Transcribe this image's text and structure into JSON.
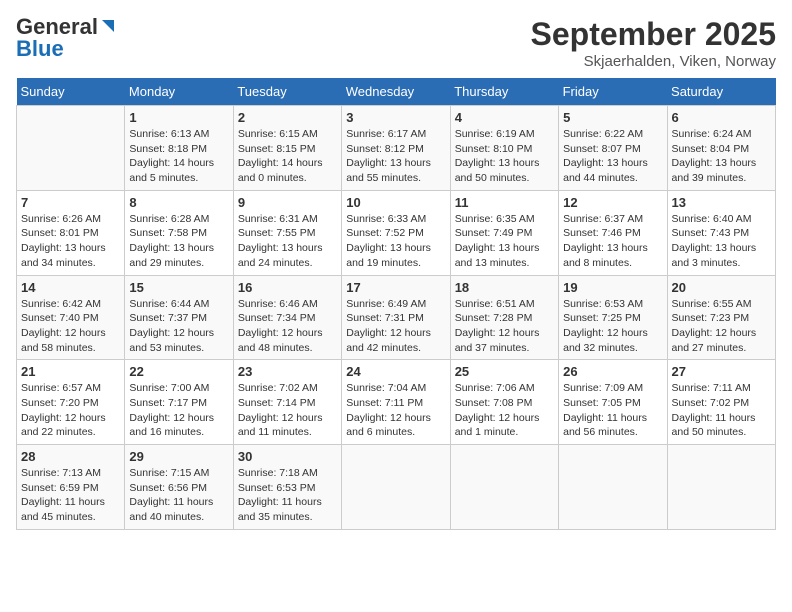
{
  "header": {
    "logo_line1": "General",
    "logo_line2": "Blue",
    "title": "September 2025",
    "subtitle": "Skjaerhalden, Viken, Norway"
  },
  "days_of_week": [
    "Sunday",
    "Monday",
    "Tuesday",
    "Wednesday",
    "Thursday",
    "Friday",
    "Saturday"
  ],
  "weeks": [
    [
      {
        "day": "",
        "content": ""
      },
      {
        "day": "1",
        "content": "Sunrise: 6:13 AM\nSunset: 8:18 PM\nDaylight: 14 hours\nand 5 minutes."
      },
      {
        "day": "2",
        "content": "Sunrise: 6:15 AM\nSunset: 8:15 PM\nDaylight: 14 hours\nand 0 minutes."
      },
      {
        "day": "3",
        "content": "Sunrise: 6:17 AM\nSunset: 8:12 PM\nDaylight: 13 hours\nand 55 minutes."
      },
      {
        "day": "4",
        "content": "Sunrise: 6:19 AM\nSunset: 8:10 PM\nDaylight: 13 hours\nand 50 minutes."
      },
      {
        "day": "5",
        "content": "Sunrise: 6:22 AM\nSunset: 8:07 PM\nDaylight: 13 hours\nand 44 minutes."
      },
      {
        "day": "6",
        "content": "Sunrise: 6:24 AM\nSunset: 8:04 PM\nDaylight: 13 hours\nand 39 minutes."
      }
    ],
    [
      {
        "day": "7",
        "content": "Sunrise: 6:26 AM\nSunset: 8:01 PM\nDaylight: 13 hours\nand 34 minutes."
      },
      {
        "day": "8",
        "content": "Sunrise: 6:28 AM\nSunset: 7:58 PM\nDaylight: 13 hours\nand 29 minutes."
      },
      {
        "day": "9",
        "content": "Sunrise: 6:31 AM\nSunset: 7:55 PM\nDaylight: 13 hours\nand 24 minutes."
      },
      {
        "day": "10",
        "content": "Sunrise: 6:33 AM\nSunset: 7:52 PM\nDaylight: 13 hours\nand 19 minutes."
      },
      {
        "day": "11",
        "content": "Sunrise: 6:35 AM\nSunset: 7:49 PM\nDaylight: 13 hours\nand 13 minutes."
      },
      {
        "day": "12",
        "content": "Sunrise: 6:37 AM\nSunset: 7:46 PM\nDaylight: 13 hours\nand 8 minutes."
      },
      {
        "day": "13",
        "content": "Sunrise: 6:40 AM\nSunset: 7:43 PM\nDaylight: 13 hours\nand 3 minutes."
      }
    ],
    [
      {
        "day": "14",
        "content": "Sunrise: 6:42 AM\nSunset: 7:40 PM\nDaylight: 12 hours\nand 58 minutes."
      },
      {
        "day": "15",
        "content": "Sunrise: 6:44 AM\nSunset: 7:37 PM\nDaylight: 12 hours\nand 53 minutes."
      },
      {
        "day": "16",
        "content": "Sunrise: 6:46 AM\nSunset: 7:34 PM\nDaylight: 12 hours\nand 48 minutes."
      },
      {
        "day": "17",
        "content": "Sunrise: 6:49 AM\nSunset: 7:31 PM\nDaylight: 12 hours\nand 42 minutes."
      },
      {
        "day": "18",
        "content": "Sunrise: 6:51 AM\nSunset: 7:28 PM\nDaylight: 12 hours\nand 37 minutes."
      },
      {
        "day": "19",
        "content": "Sunrise: 6:53 AM\nSunset: 7:25 PM\nDaylight: 12 hours\nand 32 minutes."
      },
      {
        "day": "20",
        "content": "Sunrise: 6:55 AM\nSunset: 7:23 PM\nDaylight: 12 hours\nand 27 minutes."
      }
    ],
    [
      {
        "day": "21",
        "content": "Sunrise: 6:57 AM\nSunset: 7:20 PM\nDaylight: 12 hours\nand 22 minutes."
      },
      {
        "day": "22",
        "content": "Sunrise: 7:00 AM\nSunset: 7:17 PM\nDaylight: 12 hours\nand 16 minutes."
      },
      {
        "day": "23",
        "content": "Sunrise: 7:02 AM\nSunset: 7:14 PM\nDaylight: 12 hours\nand 11 minutes."
      },
      {
        "day": "24",
        "content": "Sunrise: 7:04 AM\nSunset: 7:11 PM\nDaylight: 12 hours\nand 6 minutes."
      },
      {
        "day": "25",
        "content": "Sunrise: 7:06 AM\nSunset: 7:08 PM\nDaylight: 12 hours\nand 1 minute."
      },
      {
        "day": "26",
        "content": "Sunrise: 7:09 AM\nSunset: 7:05 PM\nDaylight: 11 hours\nand 56 minutes."
      },
      {
        "day": "27",
        "content": "Sunrise: 7:11 AM\nSunset: 7:02 PM\nDaylight: 11 hours\nand 50 minutes."
      }
    ],
    [
      {
        "day": "28",
        "content": "Sunrise: 7:13 AM\nSunset: 6:59 PM\nDaylight: 11 hours\nand 45 minutes."
      },
      {
        "day": "29",
        "content": "Sunrise: 7:15 AM\nSunset: 6:56 PM\nDaylight: 11 hours\nand 40 minutes."
      },
      {
        "day": "30",
        "content": "Sunrise: 7:18 AM\nSunset: 6:53 PM\nDaylight: 11 hours\nand 35 minutes."
      },
      {
        "day": "",
        "content": ""
      },
      {
        "day": "",
        "content": ""
      },
      {
        "day": "",
        "content": ""
      },
      {
        "day": "",
        "content": ""
      }
    ]
  ]
}
